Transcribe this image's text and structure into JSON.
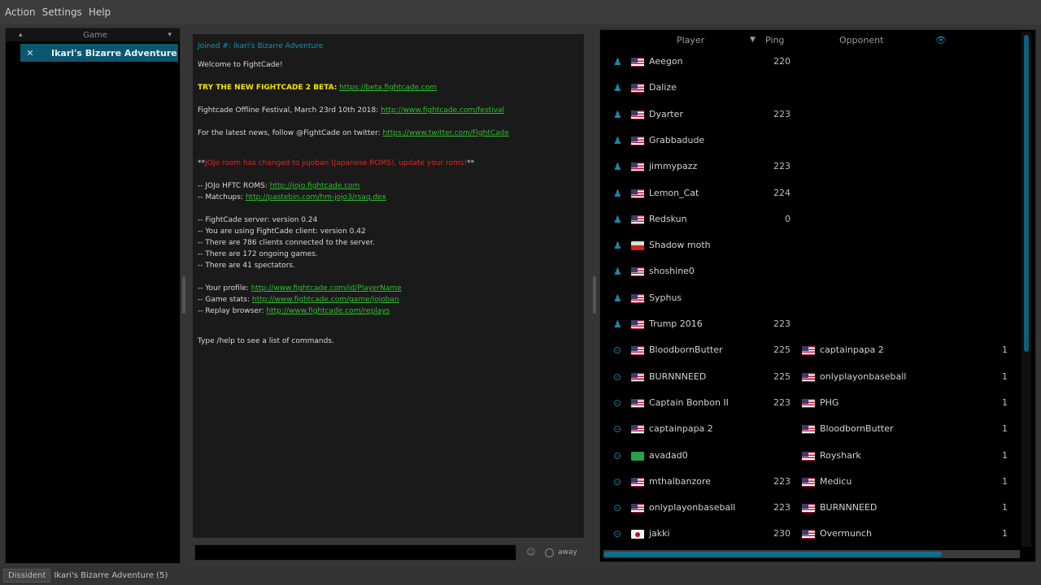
{
  "menu": [
    "Action",
    "Settings",
    "Help"
  ],
  "channels": {
    "header": "Game",
    "active": "Ikari's Bizarre Adventure"
  },
  "chat": {
    "title": "Joined #: Ikari's Bizarre Adventure",
    "welcome": "Welcome to FightCade!",
    "beta_text": "TRY THE NEW FIGHTCADE 2 BETA:",
    "beta_link": "https://beta.fightcade.com",
    "festival_text": "Fightcade Offline Festival, March 23rd 10th 2018:",
    "festival_link": "http://www.fightcade.com/festival",
    "news_text": "For the latest news, follow @FightCade on twitter:",
    "news_link": "https://www.twitter.com/FightCade",
    "warn_pre": "**",
    "warn_text": "JOJo room has changed to jojoban (Japanese ROMS), update your roms!",
    "warn_post": "**",
    "jojo_label": "-- JOJo HFTC ROMS:",
    "jojo_link": "http://jojo.fightcade.com",
    "matchups_label": "-- Matchups:",
    "matchups_link": "http://pastebin.com/hm-jojo3/rsaq.dex",
    "server_version": "-- FightCade server: version 0.24",
    "client_version": "-- You are using FightCade client: version 0.42",
    "clients": "-- There are 786 clients connected to the server.",
    "games": "-- There are 172 ongoing games.",
    "spectators": "-- There are 41 spectators.",
    "profile_label": "-- Your profile:",
    "profile_link": "http://www.fightcade.com/id/PlayerName",
    "stats_label": "-- Game stats:",
    "stats_link": "http://www.fightcade.com/game/jojoban",
    "replays_label": "-- Replay browser:",
    "replays_link": "http://www.fightcade.com/replays",
    "help": "Type /help to see a list of commands.",
    "away_label": "away"
  },
  "player_table": {
    "headers": {
      "player": "Player",
      "ping": "Ping",
      "opponent": "Opponent"
    },
    "rows": [
      {
        "status": "idle",
        "flag": "us",
        "name": "Aeegon",
        "ping": "220",
        "opp_flag": "",
        "opponent": "",
        "count": ""
      },
      {
        "status": "idle",
        "flag": "us",
        "name": "Dalize",
        "ping": "",
        "opp_flag": "",
        "opponent": "",
        "count": ""
      },
      {
        "status": "idle",
        "flag": "us",
        "name": "Dyarter",
        "ping": "223",
        "opp_flag": "",
        "opponent": "",
        "count": ""
      },
      {
        "status": "idle",
        "flag": "us",
        "name": "Grabbadude",
        "ping": "",
        "opp_flag": "",
        "opponent": "",
        "count": ""
      },
      {
        "status": "idle",
        "flag": "us",
        "name": "jimmypazz",
        "ping": "223",
        "opp_flag": "",
        "opponent": "",
        "count": ""
      },
      {
        "status": "idle",
        "flag": "us",
        "name": "Lemon_Cat",
        "ping": "224",
        "opp_flag": "",
        "opponent": "",
        "count": ""
      },
      {
        "status": "idle",
        "flag": "us",
        "name": "Redskun",
        "ping": "0",
        "opp_flag": "",
        "opponent": "",
        "count": ""
      },
      {
        "status": "idle",
        "flag": "red",
        "name": "Shadow moth",
        "ping": "",
        "opp_flag": "",
        "opponent": "",
        "count": ""
      },
      {
        "status": "idle",
        "flag": "us",
        "name": "shoshine0",
        "ping": "",
        "opp_flag": "",
        "opponent": "",
        "count": ""
      },
      {
        "status": "idle",
        "flag": "us",
        "name": "Syphus",
        "ping": "",
        "opp_flag": "",
        "opponent": "",
        "count": ""
      },
      {
        "status": "idle",
        "flag": "us",
        "name": "Trump 2016",
        "ping": "223",
        "opp_flag": "",
        "opponent": "",
        "count": ""
      },
      {
        "status": "playing",
        "flag": "us",
        "name": "BloodbornButter",
        "ping": "225",
        "opp_flag": "us",
        "opponent": "captainpapa 2",
        "count": "1"
      },
      {
        "status": "playing",
        "flag": "us",
        "name": "BURNNNEED",
        "ping": "225",
        "opp_flag": "us",
        "opponent": "onlyplayonbaseball",
        "count": "1"
      },
      {
        "status": "playing",
        "flag": "us",
        "name": "Captain Bonbon II",
        "ping": "223",
        "opp_flag": "us",
        "opponent": "PHG",
        "count": "1"
      },
      {
        "status": "playing",
        "flag": "us",
        "name": "captainpapa 2",
        "ping": "",
        "opp_flag": "us",
        "opponent": "BloodbornButter",
        "count": "1"
      },
      {
        "status": "playing",
        "flag": "green",
        "name": "avadad0",
        "ping": "",
        "opp_flag": "us",
        "opponent": "Royshark",
        "count": "1"
      },
      {
        "status": "playing",
        "flag": "us",
        "name": "mthalbanzore",
        "ping": "223",
        "opp_flag": "us",
        "opponent": "Medicu",
        "count": "1"
      },
      {
        "status": "playing",
        "flag": "us",
        "name": "onlyplayonbaseball",
        "ping": "223",
        "opp_flag": "us",
        "opponent": "BURNNNEED",
        "count": "1"
      },
      {
        "status": "playing",
        "flag": "jp",
        "name": "jakki",
        "ping": "230",
        "opp_flag": "us",
        "opponent": "Overmunch",
        "count": "1"
      }
    ]
  },
  "statusbar": {
    "tab": "Dissident",
    "game": "Ikari's Bizarre Adventure (5)"
  }
}
